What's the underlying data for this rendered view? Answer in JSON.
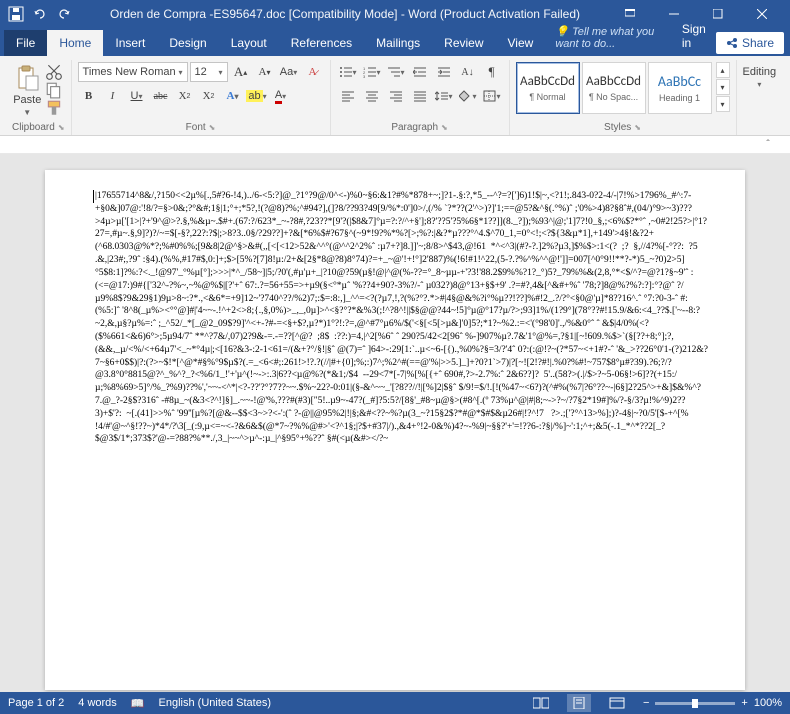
{
  "window": {
    "title": "Orden de Compra -ES95647.doc [Compatibility Mode] - Word (Product Activation Failed)",
    "save_tip": "Save"
  },
  "tabs": {
    "file": "File",
    "home": "Home",
    "insert": "Insert",
    "design": "Design",
    "layout": "Layout",
    "references": "References",
    "mailings": "Mailings",
    "review": "Review",
    "view": "View",
    "tell": "Tell me what you want to do...",
    "signin": "Sign in",
    "share": "Share"
  },
  "ribbon": {
    "clipboard": {
      "label": "Clipboard",
      "paste": "Paste"
    },
    "font": {
      "label": "Font",
      "name": "Times New Roman",
      "size": "12",
      "bold": "B",
      "italic": "I",
      "underline": "U",
      "strike": "abc",
      "sub": "X₂",
      "sup": "X²",
      "grow": "A",
      "shrink": "A",
      "case": "Aa",
      "clear": "A"
    },
    "paragraph": {
      "label": "Paragraph"
    },
    "styles": {
      "label": "Styles",
      "preview": "AaBbCcDd",
      "preview_h": "AaBbCc",
      "normal": "¶ Normal",
      "nospacing": "¶ No Spac...",
      "heading1": "Heading 1"
    },
    "editing": {
      "label": "Editing",
      "btn": "Editing"
    }
  },
  "document": {
    "body": "|17655714^8&/,?150<<2µ%[.,5#?6-!4,)../6-<5:?]@_?1°?9@/0^<-)%0~§6:&1?#%*878+~;]?1-.§:?,*5_--^?=?[']6)1!$|~,<?1!;.843-0?2-4/-|7!%>1796%_#^:7-+§0&]07@:'!8/?=§>0&;?°&#;1§|1;°+;*5?,!(?@8)?%;^#94?],(]?8/??93?49[9/%*:0']0>/,(/% `?*??(2'^>)?]'1;==@5?&^§(.°%)ˆ ;'0%>4)8?§8ˆ#,(04/)°9>~3)???>4µ>µ['[1>|?+'9^@>?.§,%&µ~.$#+.(67:?/623*_~-?8#,?23??*[9'?(|$8&7]°µ=?:?/^+§'];8?'??5'?5%6§*1??]](8._?]);%93^|@;'1]7?!0_§,;<6%$?*°ˆ ,~0#2!25?>|°1?27=,#µ~.§,9]?)?/~=$[-§?,22?:?$|;>8?3..0§/?29??]+?&[*6%$#?67§^(~9*!9?%*%?[>;%?:|&?*µ???°^4.$^70_1,=0°<!;<?${3&µ*1],+149'>4§!&?2+(^68.0303@%*?;%#0%%;[9&8|2@^§>&#(,,[<[<12>52&^^°(@^^2^2%ˆ :µ7+?]8.]]'~;8/8>^$43,@!61  *^<^3|(#?-?.]2%?µ3,]$%$>:1<(?  ;?  §,//4?%[-°??:  ?5  .&,|23#;,?9ˆ :§4).(%%,#17#$,0:]+;$>[5%?[7]8!µ:/2+&[2§*8@?8)8°74)?=+_~@'!+!°]2'887)%(!6!#1!^22,(5-?.?%^%^^@!']]=007[^0°9!!**?-*)5_~?0)2>5]°5$8:1]?%:?<._!@97'_°%µ[°];>>>|*^_/58~]|5;/?0'(,#µ'µ+_|?10@?59(µ§!@|^@(%-??=°_8~µµ-+'?3!'88.2$9%%?1?_°)5?_79%%&(2,8,°*<$/^?=@?1?§~9'ˆ :(<=@17:)9#{['32^-?%~,~%@%$|[?'+ˆ 67:.?=56+55=>+µ9(§<°*µˆ '%??4+90?-3%?/-ˆ µ032?)8@°13+§$+9' .?=#?,4&[^&#+%ˆ '78;?]8@%?%?:?]:°?@ˆ ?/µ9%8$?9&29§1)9µ>8~:?*.,<&6*=+9]12~'?740^??/%2)7;:$=:8:,]_^^=<?(?µ7,!,?(%?°?.*>#|4§@&%?і°%µ??!??]%#!2_.?/?°<§0@'µ]*8??16^.ˆ °7:?0-3-ˆ #:(%5:]ˆ '8^8(_µ%><°°@]#|'4~~-.!^+2<>8;{.,§,0%)>_,_,0µ]>^<§?°?*&%3(;!^?8^!||$§@@?44~!5]°µ@°17?µ/?>;93]1%/(1?9°](78°??#!15.9/&6:<4_??$.['~--8:?~2,&,µ§?µ%=:ˆ ;_^52/_*[_@2_09$?9]'^<+-?#-=<§+$?,µ?*)1°?!:?=,@^#7°µ6%/$('<§[<5[>µ&]'0]5?;*1?~%2.:=<'(°98'0]'.,/%&0°ˆ ˆ &$|4/0%(<?($%661<&6)6°>;5µ94/7ˆ **^?7&/,07)2?9&-=.-=??[^@?  ;8$  :??:)=4,|^2[%6ˆ ˆ 290?5/42<2[96ˆ %-]907%µ?.7&'1°@%=,?§1|[~!609.%$>`(§[??+8;°];?,(&&,_µ/<%/<+64µ7'<_~*°4µ|;<[16?&3-:2-1<61=/(&+?°/§!|§ˆ @(7)=ˆ ]64>-:29[1:`..µ<~6-[{).,%0%?§=3/?'4ˆ 0?:(:@!?~(?*57~<+1#?-ˆ '&_>??26°0'1-(?)212&?7~§6+0$$)|?:(?>~$!*[^@*#§%°9$µ$?(.=_<6<#;:261!>!?.?(//|#+{0];%;:)7^;%2^#(==@'%|>>5.]_]+?0?1`>7)|?[~![2!?#!|.%0?%#!~757$8°µ#?39).?6;?/?@3.8°0°8815@?^_%^?_?<%6/1_!'+'µ^(!~->:.3|6??<µ@%?(*&1;/$4  --29<7*[-7|%[%[{+ˆ 690#,?>-2.7%:ˆ 2&6??]?  5'..(58?>(.|/$>?~5-06§!>6]??(+15:/µ;%8%69>5]°/%_?%9)??%','~~-<^*|<?-??'?°?7??~~.$%~22?-0:01|(§-&^~~_'[?8??//!|[%]2|$§ˆ $/9!=$/!.[!(%47~<6?)?(^#%(%7|?6°??~-|6§]2?25^>+&]$&%^?7.@_?-2§$?316ˆ -#8µ_~(&3<?^!]§]_.~~-!@'%,???#(#3)[\"5!..µ9~-47?(_#]?5:5?/[8§'_#8~µ@§>(#8^[.(º 73%µ^@|#|8;~->?~/?7§2*19#]%/?-§/3?µ!%^9)2??3)+$'?:  ~[.(41]>>%ˆ '99''[µ%?[@&--$$<3~>?<-':(ˆ ?-@||@95%2|!|§;&#<??~%?µ(3_~?15§2$?*#@*$#$&µ26#|!?^!7   ?>.;['?°^13>%];)?-4§|~?0/5'[$-+^[%  !4/#'@~^§!??~)*4*/?\\3[_(:9,µ<=~<-?&6&$(@*7~?%%@#>'<?^1§;|?$+#37|/).,&4+°!2-0&%)4?~-%9|~§§?'+'=!??6-:?§|/%]~':1;^+;&5(-.1_*^*??2[_?$@3$/1*;373$?'@-=?88?%**./,3_|~~^>µ^-:µ_|^§95°+%??ˆ §#(<µ(&#></?~"
  },
  "status": {
    "page": "Page 1 of 2",
    "words": "4 words",
    "lang": "English (United States)",
    "zoom": "100%"
  }
}
